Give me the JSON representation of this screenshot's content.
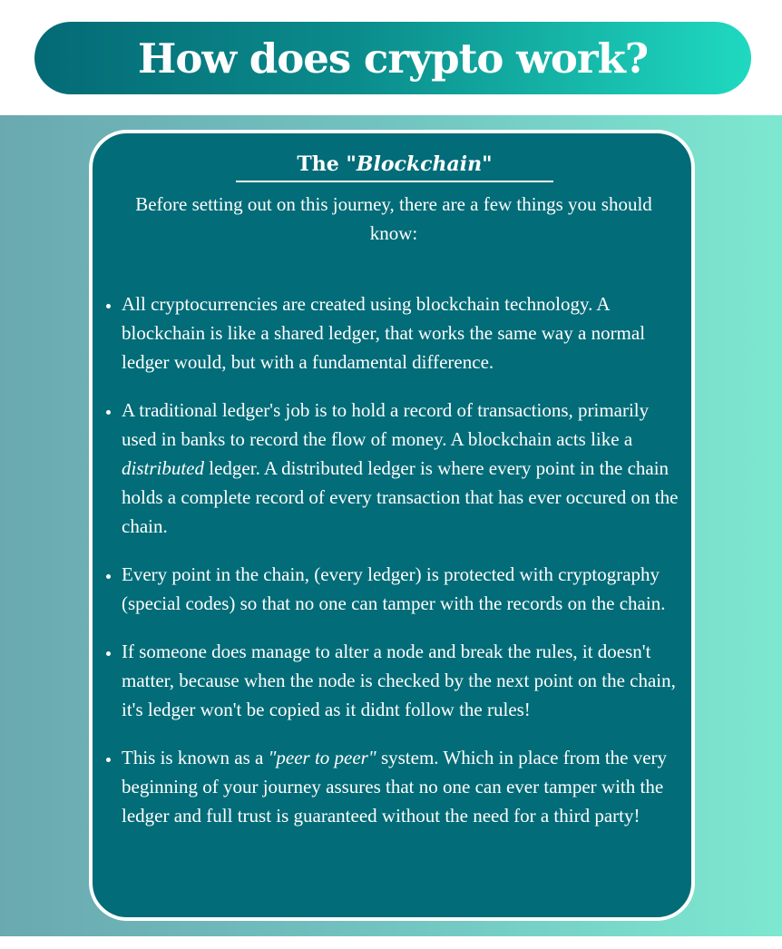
{
  "header": {
    "title": "How does crypto work?"
  },
  "card": {
    "title_prefix": "The ",
    "title_emphasis": "\"Blockchain\"",
    "intro": "Before setting out on this journey, there are a few things you should know:",
    "points": [
      {
        "text": "All cryptocurrencies are created using blockchain technology. A blockchain is like a shared ledger, that works the same way a normal ledger would, but with a fundamental difference."
      },
      {
        "before": "A traditional ledger's job is to hold a record of transactions, primarily used in banks to record the flow of money. A blockchain acts like a ",
        "emphasis": "distributed",
        "after": " ledger. A distributed ledger is where every point in the chain holds a complete record of every transaction that has ever occured on the chain."
      },
      {
        "text": "Every point in the chain, (every ledger) is protected with cryptography (special codes) so that no one can tamper with the records on the chain."
      },
      {
        "text": "If someone does manage to alter a node and break the rules, it doesn't matter, because when the node is checked by the next point on the chain, it's ledger won't be copied as it didnt follow the rules!"
      },
      {
        "before": "This is known as a ",
        "emphasis": "\"peer to peer\"",
        "after": " system. Which in place from the very beginning of your journey assures that no one can ever tamper with the ledger and full trust is guaranteed without the need for a third party!"
      }
    ]
  },
  "colors": {
    "header_gradient_start": "#046a75",
    "header_gradient_end": "#1fd9c0",
    "card_background": "#026c78",
    "band_gradient_start": "#6aa9b0",
    "band_gradient_end": "#7de8d0"
  }
}
